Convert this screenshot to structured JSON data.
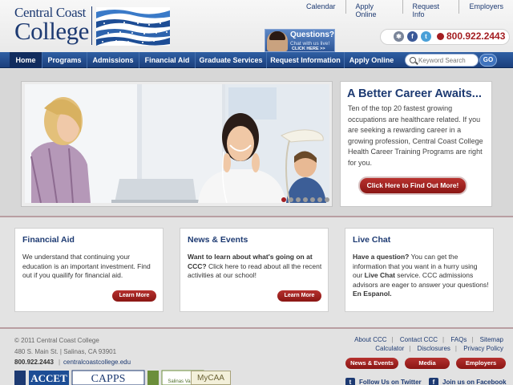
{
  "header": {
    "logo_line1": "Central Coast",
    "logo_line2": "College",
    "top_links": [
      "Calendar",
      "Apply Online",
      "Request Info",
      "Employers"
    ],
    "chat": {
      "title": "Questions?",
      "subtitle": "Chat with us live!",
      "cta": "CLICK HERE >>"
    },
    "phone": "800.922.2443"
  },
  "nav": {
    "items": [
      "Home",
      "Programs",
      "Admissions",
      "Financial Aid",
      "Graduate Services",
      "Request Information",
      "Apply Online"
    ],
    "active": "Home",
    "search_placeholder": "Keyword Search",
    "go_label": "GO"
  },
  "hero": {
    "title": "A Better Career Awaits...",
    "body": "Ten of the top 20 fastest growing occupations are healthcare related. If you are seeking a rewarding career in a growing profession, Central Coast College Health Career Training Programs are right for you.",
    "cta": "Click Here to Find Out More!",
    "slide_count": 7,
    "active_slide": 1
  },
  "boxes": {
    "financial": {
      "title": "Financial Aid",
      "body": "We understand that continuing your education is an important investment. Find out if you quailify for financial aid.",
      "button": "Learn More"
    },
    "news": {
      "title": "News & Events",
      "lead": "Want to learn about what's going on at CCC?",
      "body": " Click here to read about all the recent activities at our school!",
      "button": "Learn More"
    },
    "chat": {
      "title": "Live Chat",
      "lead": "Have a question?",
      "body1": " You can get the information that you want in a hurry using our ",
      "bold": "Live Chat",
      "body2": " service. CCC admissions advisors are eager to answer your questions! ",
      "spanish": "En Espanol."
    }
  },
  "footer": {
    "copyright": "© 2011 Central Coast College",
    "address": "480 S. Main St. | Salinas, CA 93901",
    "phone": "800.922.2443",
    "separator": "|",
    "website": "centralcoastcollege.edu",
    "links_row1": [
      "About CCC",
      "Contact CCC",
      "FAQs",
      "Sitemap"
    ],
    "links_row2": [
      "Calculator",
      "Disclosures",
      "Privacy Policy"
    ],
    "buttons": [
      "News & Events",
      "Media",
      "Employers"
    ],
    "twitter": "Follow Us on Twitter",
    "facebook": "Join us on Facebook",
    "logos": [
      "ACCET",
      "CAPPS",
      "Salinas Valley",
      "MyCAA"
    ]
  },
  "colors": {
    "brand_blue": "#1d3a72",
    "nav_blue": "#24508f",
    "accent_red": "#a41e22"
  }
}
